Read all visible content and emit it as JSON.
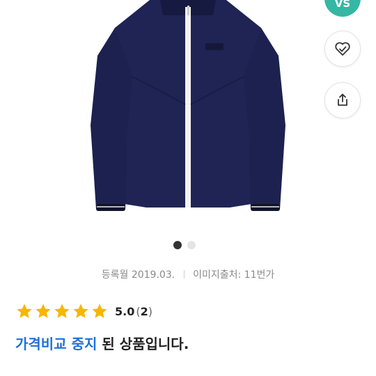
{
  "product": {
    "image_alt": "navy full-zip jacket with white zipper"
  },
  "badge": {
    "label": "VS"
  },
  "actions": {
    "wish_icon": "heart-check-icon",
    "share_icon": "share-icon"
  },
  "gallery": {
    "total": 2,
    "current": 1
  },
  "meta": {
    "registered": "등록월 2019.03.",
    "source": "이미지출처: 11번가"
  },
  "rating": {
    "stars": 5,
    "score": "5.0",
    "count_open": "(",
    "count": "2",
    "count_close": ")"
  },
  "notice": {
    "highlight": "가격비교 중지",
    "rest": " 된 상품입니다."
  },
  "colors": {
    "accent_blue": "#1e6fd9",
    "star_yellow": "#f5b800",
    "badge_green": "#35b7a3"
  }
}
